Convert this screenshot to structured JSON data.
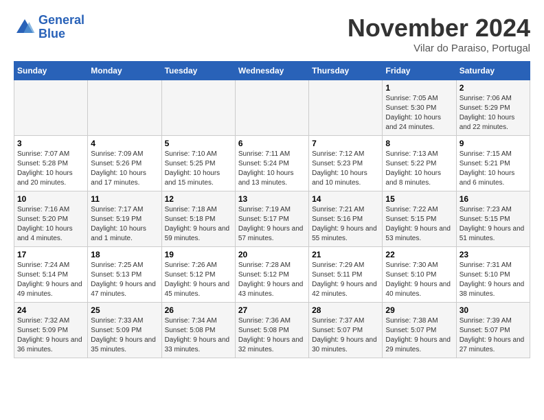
{
  "header": {
    "logo_line1": "General",
    "logo_line2": "Blue",
    "month_title": "November 2024",
    "location": "Vilar do Paraiso, Portugal"
  },
  "days_of_week": [
    "Sunday",
    "Monday",
    "Tuesday",
    "Wednesday",
    "Thursday",
    "Friday",
    "Saturday"
  ],
  "weeks": [
    [
      {
        "day": "",
        "info": ""
      },
      {
        "day": "",
        "info": ""
      },
      {
        "day": "",
        "info": ""
      },
      {
        "day": "",
        "info": ""
      },
      {
        "day": "",
        "info": ""
      },
      {
        "day": "1",
        "info": "Sunrise: 7:05 AM\nSunset: 5:30 PM\nDaylight: 10 hours and 24 minutes."
      },
      {
        "day": "2",
        "info": "Sunrise: 7:06 AM\nSunset: 5:29 PM\nDaylight: 10 hours and 22 minutes."
      }
    ],
    [
      {
        "day": "3",
        "info": "Sunrise: 7:07 AM\nSunset: 5:28 PM\nDaylight: 10 hours and 20 minutes."
      },
      {
        "day": "4",
        "info": "Sunrise: 7:09 AM\nSunset: 5:26 PM\nDaylight: 10 hours and 17 minutes."
      },
      {
        "day": "5",
        "info": "Sunrise: 7:10 AM\nSunset: 5:25 PM\nDaylight: 10 hours and 15 minutes."
      },
      {
        "day": "6",
        "info": "Sunrise: 7:11 AM\nSunset: 5:24 PM\nDaylight: 10 hours and 13 minutes."
      },
      {
        "day": "7",
        "info": "Sunrise: 7:12 AM\nSunset: 5:23 PM\nDaylight: 10 hours and 10 minutes."
      },
      {
        "day": "8",
        "info": "Sunrise: 7:13 AM\nSunset: 5:22 PM\nDaylight: 10 hours and 8 minutes."
      },
      {
        "day": "9",
        "info": "Sunrise: 7:15 AM\nSunset: 5:21 PM\nDaylight: 10 hours and 6 minutes."
      }
    ],
    [
      {
        "day": "10",
        "info": "Sunrise: 7:16 AM\nSunset: 5:20 PM\nDaylight: 10 hours and 4 minutes."
      },
      {
        "day": "11",
        "info": "Sunrise: 7:17 AM\nSunset: 5:19 PM\nDaylight: 10 hours and 1 minute."
      },
      {
        "day": "12",
        "info": "Sunrise: 7:18 AM\nSunset: 5:18 PM\nDaylight: 9 hours and 59 minutes."
      },
      {
        "day": "13",
        "info": "Sunrise: 7:19 AM\nSunset: 5:17 PM\nDaylight: 9 hours and 57 minutes."
      },
      {
        "day": "14",
        "info": "Sunrise: 7:21 AM\nSunset: 5:16 PM\nDaylight: 9 hours and 55 minutes."
      },
      {
        "day": "15",
        "info": "Sunrise: 7:22 AM\nSunset: 5:15 PM\nDaylight: 9 hours and 53 minutes."
      },
      {
        "day": "16",
        "info": "Sunrise: 7:23 AM\nSunset: 5:15 PM\nDaylight: 9 hours and 51 minutes."
      }
    ],
    [
      {
        "day": "17",
        "info": "Sunrise: 7:24 AM\nSunset: 5:14 PM\nDaylight: 9 hours and 49 minutes."
      },
      {
        "day": "18",
        "info": "Sunrise: 7:25 AM\nSunset: 5:13 PM\nDaylight: 9 hours and 47 minutes."
      },
      {
        "day": "19",
        "info": "Sunrise: 7:26 AM\nSunset: 5:12 PM\nDaylight: 9 hours and 45 minutes."
      },
      {
        "day": "20",
        "info": "Sunrise: 7:28 AM\nSunset: 5:12 PM\nDaylight: 9 hours and 43 minutes."
      },
      {
        "day": "21",
        "info": "Sunrise: 7:29 AM\nSunset: 5:11 PM\nDaylight: 9 hours and 42 minutes."
      },
      {
        "day": "22",
        "info": "Sunrise: 7:30 AM\nSunset: 5:10 PM\nDaylight: 9 hours and 40 minutes."
      },
      {
        "day": "23",
        "info": "Sunrise: 7:31 AM\nSunset: 5:10 PM\nDaylight: 9 hours and 38 minutes."
      }
    ],
    [
      {
        "day": "24",
        "info": "Sunrise: 7:32 AM\nSunset: 5:09 PM\nDaylight: 9 hours and 36 minutes."
      },
      {
        "day": "25",
        "info": "Sunrise: 7:33 AM\nSunset: 5:09 PM\nDaylight: 9 hours and 35 minutes."
      },
      {
        "day": "26",
        "info": "Sunrise: 7:34 AM\nSunset: 5:08 PM\nDaylight: 9 hours and 33 minutes."
      },
      {
        "day": "27",
        "info": "Sunrise: 7:36 AM\nSunset: 5:08 PM\nDaylight: 9 hours and 32 minutes."
      },
      {
        "day": "28",
        "info": "Sunrise: 7:37 AM\nSunset: 5:07 PM\nDaylight: 9 hours and 30 minutes."
      },
      {
        "day": "29",
        "info": "Sunrise: 7:38 AM\nSunset: 5:07 PM\nDaylight: 9 hours and 29 minutes."
      },
      {
        "day": "30",
        "info": "Sunrise: 7:39 AM\nSunset: 5:07 PM\nDaylight: 9 hours and 27 minutes."
      }
    ]
  ]
}
